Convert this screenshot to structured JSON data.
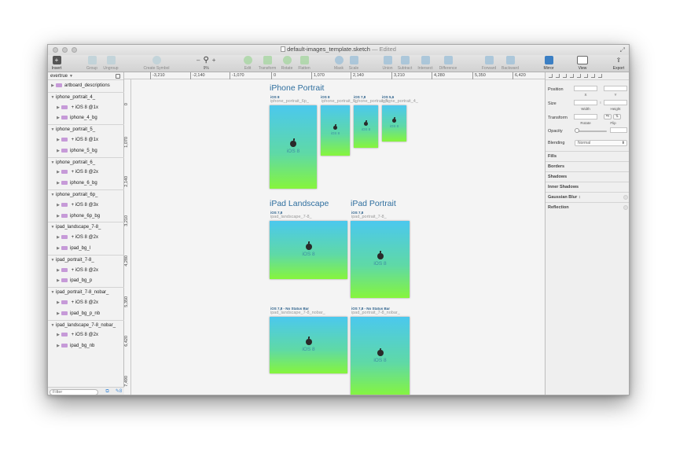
{
  "window": {
    "title": "default-images_template.sketch",
    "edited": "— Edited"
  },
  "toolbar": {
    "insert": "Insert",
    "group": "Group",
    "ungroup": "Ungroup",
    "create_symbol": "Create Symbol",
    "zoom_minus": "–",
    "zoom_plus": "+",
    "zoom_level": "9%",
    "edit": "Edit",
    "transform": "Transform",
    "rotate": "Rotate",
    "flatten": "Flatten",
    "mask": "Mask",
    "scale": "Scale",
    "union": "Union",
    "subtract": "Subtract",
    "intersect": "Intersect",
    "difference": "Difference",
    "forward": "Forward",
    "backward": "Backward",
    "mirror": "Mirror",
    "view": "View",
    "export": "Export"
  },
  "ruler": {
    "h_ticks": [
      "-3,210",
      "-2,140",
      "-1,070",
      "0",
      "1,070",
      "2,140",
      "3,210",
      "4,280",
      "5,350",
      "6,420"
    ],
    "v_ticks": [
      "0",
      "1,070",
      "2,140",
      "3,210",
      "4,280",
      "5,350",
      "6,420",
      "7,490"
    ]
  },
  "sidebar": {
    "page_name": "evertrue",
    "layers": [
      {
        "name": "artboard_descriptions",
        "level": 0,
        "kind": "folder"
      },
      {
        "name": "iphone_portrait_4_",
        "level": 0,
        "kind": "artboard"
      },
      {
        "name": " + iOS 8 @1x",
        "level": 1,
        "kind": "folder"
      },
      {
        "name": "iphone_4_bg",
        "level": 1,
        "kind": "folder"
      },
      {
        "name": "iphone_portrait_5_",
        "level": 0,
        "kind": "artboard"
      },
      {
        "name": " + iOS 8 @1x",
        "level": 1,
        "kind": "folder"
      },
      {
        "name": "iphone_5_bg",
        "level": 1,
        "kind": "folder"
      },
      {
        "name": "iphone_portrait_6_",
        "level": 0,
        "kind": "artboard"
      },
      {
        "name": " + iOS 8 @2x",
        "level": 1,
        "kind": "folder"
      },
      {
        "name": "iphone_6_bg",
        "level": 1,
        "kind": "folder"
      },
      {
        "name": "iphone_portrait_6p_",
        "level": 0,
        "kind": "artboard"
      },
      {
        "name": " + iOS 8 @3x",
        "level": 1,
        "kind": "folder"
      },
      {
        "name": "iphone_6p_bg",
        "level": 1,
        "kind": "folder"
      },
      {
        "name": "ipad_landscape_7-8_",
        "level": 0,
        "kind": "artboard"
      },
      {
        "name": " + iOS 8 @2x",
        "level": 1,
        "kind": "folder"
      },
      {
        "name": "ipad_bg_l",
        "level": 1,
        "kind": "folder"
      },
      {
        "name": "ipad_portrait_7-8_",
        "level": 0,
        "kind": "artboard"
      },
      {
        "name": " + iOS 8 @2x",
        "level": 1,
        "kind": "folder"
      },
      {
        "name": "ipad_bg_p",
        "level": 1,
        "kind": "folder"
      },
      {
        "name": "ipad_portrait_7-8_nobar_",
        "level": 0,
        "kind": "artboard"
      },
      {
        "name": " + iOS 8 @2x",
        "level": 1,
        "kind": "folder"
      },
      {
        "name": "ipad_bg_p_nb",
        "level": 1,
        "kind": "folder"
      },
      {
        "name": "ipad_landscape_7-8_nobar_",
        "level": 0,
        "kind": "artboard"
      },
      {
        "name": " + iOS 8 @2x",
        "level": 1,
        "kind": "folder"
      },
      {
        "name": "ipad_bg_nb",
        "level": 1,
        "kind": "folder"
      }
    ],
    "filter_placeholder": "Filter",
    "filter_count": "8"
  },
  "canvas": {
    "iphone_title": "iPhone Portrait",
    "ipad_landscape_title": "iPad Landscape",
    "ipad_portrait_title": "iPad Portrait",
    "iphone_boards": [
      {
        "tag": "iOS 8",
        "name": "iphone_portrait_6p_"
      },
      {
        "tag": "iOS 8",
        "name": "iphone_portrait_6_"
      },
      {
        "tag": "iOS 7,8",
        "name": "iphone_portrait_5_"
      },
      {
        "tag": "iOS 5,6",
        "name": "iphone_portrait_4_"
      }
    ],
    "ipad_boards": [
      {
        "tag": "iOS 7,8",
        "name": "ipad_landscape_7-8_"
      },
      {
        "tag": "iOS 7,8",
        "name": "ipad_portrait_7-8_"
      },
      {
        "tag": "iOS 7,8 - No Status Bar",
        "name": "ipad_landscape_7-8_nobar_"
      },
      {
        "tag": "iOS 7,8 - No Status Bar",
        "name": "ipad_portrait_7-8_nobar_"
      }
    ],
    "artboard_label": "iOS 8"
  },
  "inspector": {
    "position": "Position",
    "x": "X",
    "y": "Y",
    "size": "Size",
    "width": "Width",
    "height": "Height",
    "transform": "Transform",
    "rotate": "Rotate",
    "flip": "Flip",
    "opacity": "Opacity",
    "blending": "Blending",
    "blending_value": "Normal",
    "fills": "Fills",
    "borders": "Borders",
    "shadows": "Shadows",
    "inner_shadows": "Inner Shadows",
    "gaussian_blur": "Gaussian Blur ↕",
    "reflection": "Reflection"
  },
  "colors": {
    "gradient_top": "#4bc8ee",
    "gradient_mid": "#5fd9a6",
    "gradient_bottom": "#86f53c",
    "section_title": "#2f6f9f"
  }
}
